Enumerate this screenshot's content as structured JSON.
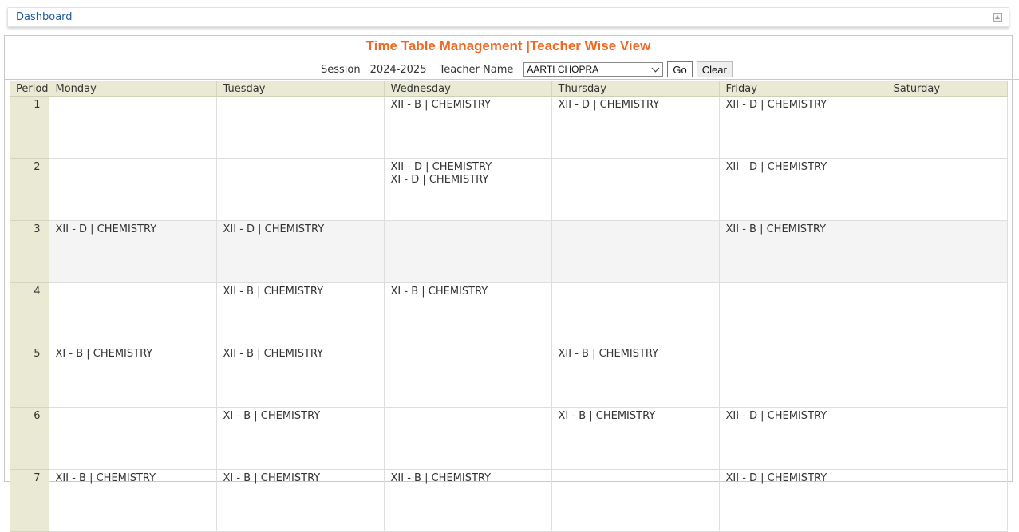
{
  "topbar": {
    "breadcrumb": "Dashboard",
    "collapse_icon": "collapse-icon"
  },
  "title": "Time Table Management |Teacher Wise View",
  "filters": {
    "session_label": "Session",
    "session_value": "2024-2025",
    "teacher_label": "Teacher Name",
    "teacher_selected": "AARTI CHOPRA",
    "go_label": "Go",
    "clear_label": "Clear"
  },
  "colors": {
    "title": "#f26722",
    "header_bg": "#e9e9d4",
    "link": "#1f5b99"
  },
  "timetable": {
    "columns": [
      "Period",
      "Monday",
      "Tuesday",
      "Wednesday",
      "Thursday",
      "Friday",
      "Saturday"
    ],
    "rows": [
      {
        "period": "1",
        "cells": [
          [],
          [],
          [
            "XII - B | CHEMISTRY"
          ],
          [
            "XII - D | CHEMISTRY"
          ],
          [
            "XII - D | CHEMISTRY"
          ],
          []
        ]
      },
      {
        "period": "2",
        "cells": [
          [],
          [],
          [
            "XII - D | CHEMISTRY",
            "XI - D | CHEMISTRY"
          ],
          [],
          [
            "XII - D | CHEMISTRY"
          ],
          []
        ]
      },
      {
        "period": "3",
        "cells": [
          [
            "XII - D | CHEMISTRY"
          ],
          [
            "XII - D | CHEMISTRY"
          ],
          [],
          [],
          [
            "XII - B | CHEMISTRY"
          ],
          []
        ]
      },
      {
        "period": "4",
        "cells": [
          [],
          [
            "XII - B | CHEMISTRY"
          ],
          [
            "XI - B | CHEMISTRY"
          ],
          [],
          [],
          []
        ]
      },
      {
        "period": "5",
        "cells": [
          [
            "XI - B | CHEMISTRY"
          ],
          [
            "XII - B | CHEMISTRY"
          ],
          [],
          [
            "XII - B | CHEMISTRY"
          ],
          [],
          []
        ]
      },
      {
        "period": "6",
        "cells": [
          [],
          [
            "XI - B | CHEMISTRY"
          ],
          [],
          [
            "XI - B | CHEMISTRY"
          ],
          [
            "XII - D | CHEMISTRY"
          ],
          []
        ]
      },
      {
        "period": "7",
        "cells": [
          [
            "XII - B | CHEMISTRY"
          ],
          [
            "XI - B | CHEMISTRY"
          ],
          [
            "XII - B | CHEMISTRY"
          ],
          [],
          [
            "XII - D | CHEMISTRY"
          ],
          []
        ]
      }
    ]
  }
}
